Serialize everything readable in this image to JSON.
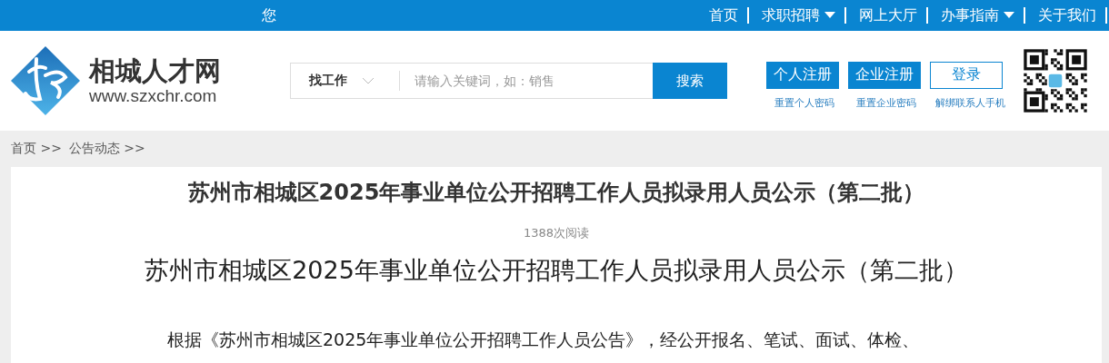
{
  "top_bar": {
    "greeting": "您",
    "nav": [
      {
        "label": "首页",
        "has_dropdown": false
      },
      {
        "label": "求职招聘",
        "has_dropdown": true
      },
      {
        "label": "网上大厅",
        "has_dropdown": false
      },
      {
        "label": "办事指南",
        "has_dropdown": true
      },
      {
        "label": "关于我们",
        "has_dropdown": false
      }
    ]
  },
  "header": {
    "site_name": "相城人才网",
    "site_url": "www.szxchr.com",
    "search": {
      "category": "找工作",
      "placeholder": "请输入关键词，如：销售",
      "button": "搜索"
    },
    "account_buttons": [
      {
        "label": "个人注册",
        "kind": "filled"
      },
      {
        "label": "企业注册",
        "kind": "filled"
      },
      {
        "label": "登录",
        "kind": "outline"
      }
    ],
    "account_links": [
      "重置个人密码",
      "重置企业密码",
      "解绑联系人手机"
    ]
  },
  "breadcrumb": [
    "首页 >>",
    "公告动态 >>"
  ],
  "article": {
    "title": "苏州市相城区2025年事业单位公开招聘工作人员拟录用人员公示（第二批）",
    "views": "1388次阅读",
    "heading": "苏州市相城区2025年事业单位公开招聘工作人员拟录用人员公示（第二批）",
    "body": "根据《苏州市相城区2025年事业单位公开招聘工作人员公告》，经公开报名、笔试、面试、体检、"
  }
}
